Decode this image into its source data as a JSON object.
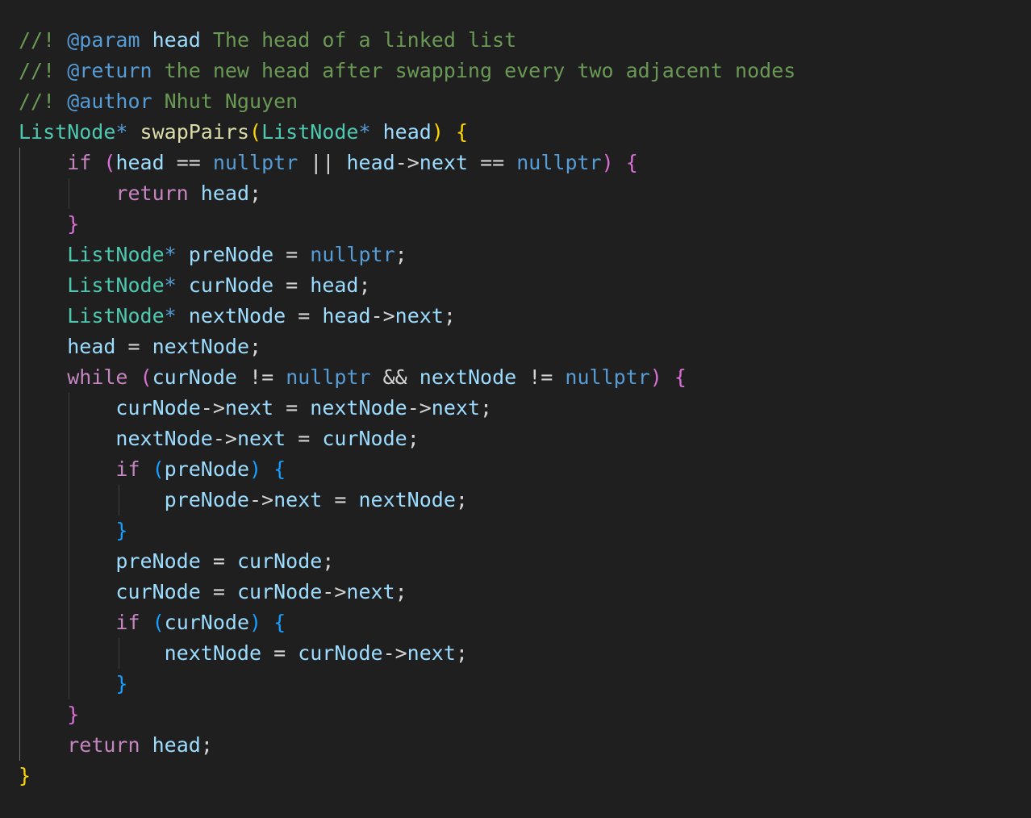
{
  "editor": {
    "theme": "dark",
    "background": "#1f1f1f",
    "colors": {
      "comment": "#6a9955",
      "doc_tag": "#569cd6",
      "type": "#4ec9b0",
      "function": "#dcdcaa",
      "variable": "#9cdcfe",
      "keyword": "#569cd6",
      "control": "#c586c0",
      "bracket_level_1": "#ffd700",
      "bracket_level_2": "#da70d6",
      "bracket_level_3": "#179fff"
    },
    "lines": [
      {
        "indent": 0,
        "guides": [],
        "tokens": [
          {
            "t": "comment",
            "v": "//! "
          },
          {
            "t": "doctag",
            "v": "@param"
          },
          {
            "t": "comment",
            "v": " "
          },
          {
            "t": "doctext",
            "v": "head"
          },
          {
            "t": "comment",
            "v": " The head of a linked list"
          }
        ]
      },
      {
        "indent": 0,
        "guides": [],
        "tokens": [
          {
            "t": "comment",
            "v": "//! "
          },
          {
            "t": "doctag",
            "v": "@return"
          },
          {
            "t": "comment",
            "v": " the new head after swapping every two adjacent nodes"
          }
        ]
      },
      {
        "indent": 0,
        "guides": [],
        "tokens": [
          {
            "t": "comment",
            "v": "//! "
          },
          {
            "t": "doctag",
            "v": "@author"
          },
          {
            "t": "comment",
            "v": " Nhut Nguyen"
          }
        ]
      },
      {
        "indent": 0,
        "guides": [],
        "tokens": [
          {
            "t": "type",
            "v": "ListNode"
          },
          {
            "t": "keyword",
            "v": "*"
          },
          {
            "t": "op",
            "v": " "
          },
          {
            "t": "func",
            "v": "swapPairs"
          },
          {
            "t": "brace-1",
            "v": "("
          },
          {
            "t": "type",
            "v": "ListNode"
          },
          {
            "t": "keyword",
            "v": "*"
          },
          {
            "t": "op",
            "v": " "
          },
          {
            "t": "param",
            "v": "head"
          },
          {
            "t": "brace-1",
            "v": ")"
          },
          {
            "t": "op",
            "v": " "
          },
          {
            "t": "brace-1",
            "v": "{"
          }
        ]
      },
      {
        "indent": 1,
        "guides": [
          0
        ],
        "tokens": [
          {
            "t": "control",
            "v": "if"
          },
          {
            "t": "op",
            "v": " "
          },
          {
            "t": "brace-2",
            "v": "("
          },
          {
            "t": "var",
            "v": "head"
          },
          {
            "t": "op",
            "v": " == "
          },
          {
            "t": "keyword",
            "v": "nullptr"
          },
          {
            "t": "op",
            "v": " || "
          },
          {
            "t": "var",
            "v": "head"
          },
          {
            "t": "op",
            "v": "->"
          },
          {
            "t": "var",
            "v": "next"
          },
          {
            "t": "op",
            "v": " == "
          },
          {
            "t": "keyword",
            "v": "nullptr"
          },
          {
            "t": "brace-2",
            "v": ")"
          },
          {
            "t": "op",
            "v": " "
          },
          {
            "t": "brace-2",
            "v": "{"
          }
        ]
      },
      {
        "indent": 2,
        "guides": [
          0,
          1
        ],
        "tokens": [
          {
            "t": "control",
            "v": "return"
          },
          {
            "t": "op",
            "v": " "
          },
          {
            "t": "var",
            "v": "head"
          },
          {
            "t": "punct",
            "v": ";"
          }
        ]
      },
      {
        "indent": 1,
        "guides": [
          0
        ],
        "tokens": [
          {
            "t": "brace-2",
            "v": "}"
          }
        ]
      },
      {
        "indent": 1,
        "guides": [
          0
        ],
        "tokens": [
          {
            "t": "type",
            "v": "ListNode"
          },
          {
            "t": "keyword",
            "v": "*"
          },
          {
            "t": "op",
            "v": " "
          },
          {
            "t": "var",
            "v": "preNode"
          },
          {
            "t": "op",
            "v": " = "
          },
          {
            "t": "keyword",
            "v": "nullptr"
          },
          {
            "t": "punct",
            "v": ";"
          }
        ]
      },
      {
        "indent": 1,
        "guides": [
          0
        ],
        "tokens": [
          {
            "t": "type",
            "v": "ListNode"
          },
          {
            "t": "keyword",
            "v": "*"
          },
          {
            "t": "op",
            "v": " "
          },
          {
            "t": "var",
            "v": "curNode"
          },
          {
            "t": "op",
            "v": " = "
          },
          {
            "t": "var",
            "v": "head"
          },
          {
            "t": "punct",
            "v": ";"
          }
        ]
      },
      {
        "indent": 1,
        "guides": [
          0
        ],
        "tokens": [
          {
            "t": "type",
            "v": "ListNode"
          },
          {
            "t": "keyword",
            "v": "*"
          },
          {
            "t": "op",
            "v": " "
          },
          {
            "t": "var",
            "v": "nextNode"
          },
          {
            "t": "op",
            "v": " = "
          },
          {
            "t": "var",
            "v": "head"
          },
          {
            "t": "op",
            "v": "->"
          },
          {
            "t": "var",
            "v": "next"
          },
          {
            "t": "punct",
            "v": ";"
          }
        ]
      },
      {
        "indent": 1,
        "guides": [
          0
        ],
        "tokens": [
          {
            "t": "var",
            "v": "head"
          },
          {
            "t": "op",
            "v": " = "
          },
          {
            "t": "var",
            "v": "nextNode"
          },
          {
            "t": "punct",
            "v": ";"
          }
        ]
      },
      {
        "indent": 1,
        "guides": [
          0
        ],
        "tokens": [
          {
            "t": "control",
            "v": "while"
          },
          {
            "t": "op",
            "v": " "
          },
          {
            "t": "brace-2",
            "v": "("
          },
          {
            "t": "var",
            "v": "curNode"
          },
          {
            "t": "op",
            "v": " != "
          },
          {
            "t": "keyword",
            "v": "nullptr"
          },
          {
            "t": "op",
            "v": " && "
          },
          {
            "t": "var",
            "v": "nextNode"
          },
          {
            "t": "op",
            "v": " != "
          },
          {
            "t": "keyword",
            "v": "nullptr"
          },
          {
            "t": "brace-2",
            "v": ")"
          },
          {
            "t": "op",
            "v": " "
          },
          {
            "t": "brace-2",
            "v": "{"
          }
        ]
      },
      {
        "indent": 2,
        "guides": [
          0,
          1
        ],
        "tokens": [
          {
            "t": "var",
            "v": "curNode"
          },
          {
            "t": "op",
            "v": "->"
          },
          {
            "t": "var",
            "v": "next"
          },
          {
            "t": "op",
            "v": " = "
          },
          {
            "t": "var",
            "v": "nextNode"
          },
          {
            "t": "op",
            "v": "->"
          },
          {
            "t": "var",
            "v": "next"
          },
          {
            "t": "punct",
            "v": ";"
          }
        ]
      },
      {
        "indent": 2,
        "guides": [
          0,
          1
        ],
        "tokens": [
          {
            "t": "var",
            "v": "nextNode"
          },
          {
            "t": "op",
            "v": "->"
          },
          {
            "t": "var",
            "v": "next"
          },
          {
            "t": "op",
            "v": " = "
          },
          {
            "t": "var",
            "v": "curNode"
          },
          {
            "t": "punct",
            "v": ";"
          }
        ]
      },
      {
        "indent": 2,
        "guides": [
          0,
          1
        ],
        "tokens": [
          {
            "t": "control",
            "v": "if"
          },
          {
            "t": "op",
            "v": " "
          },
          {
            "t": "brace-3",
            "v": "("
          },
          {
            "t": "var",
            "v": "preNode"
          },
          {
            "t": "brace-3",
            "v": ")"
          },
          {
            "t": "op",
            "v": " "
          },
          {
            "t": "brace-3",
            "v": "{"
          }
        ]
      },
      {
        "indent": 3,
        "guides": [
          0,
          1,
          2
        ],
        "tokens": [
          {
            "t": "var",
            "v": "preNode"
          },
          {
            "t": "op",
            "v": "->"
          },
          {
            "t": "var",
            "v": "next"
          },
          {
            "t": "op",
            "v": " = "
          },
          {
            "t": "var",
            "v": "nextNode"
          },
          {
            "t": "punct",
            "v": ";"
          }
        ]
      },
      {
        "indent": 2,
        "guides": [
          0,
          1
        ],
        "tokens": [
          {
            "t": "brace-3",
            "v": "}"
          }
        ]
      },
      {
        "indent": 2,
        "guides": [
          0,
          1
        ],
        "tokens": [
          {
            "t": "var",
            "v": "preNode"
          },
          {
            "t": "op",
            "v": " = "
          },
          {
            "t": "var",
            "v": "curNode"
          },
          {
            "t": "punct",
            "v": ";"
          }
        ]
      },
      {
        "indent": 2,
        "guides": [
          0,
          1
        ],
        "tokens": [
          {
            "t": "var",
            "v": "curNode"
          },
          {
            "t": "op",
            "v": " = "
          },
          {
            "t": "var",
            "v": "curNode"
          },
          {
            "t": "op",
            "v": "->"
          },
          {
            "t": "var",
            "v": "next"
          },
          {
            "t": "punct",
            "v": ";"
          }
        ]
      },
      {
        "indent": 2,
        "guides": [
          0,
          1
        ],
        "tokens": [
          {
            "t": "control",
            "v": "if"
          },
          {
            "t": "op",
            "v": " "
          },
          {
            "t": "brace-3",
            "v": "("
          },
          {
            "t": "var",
            "v": "curNode"
          },
          {
            "t": "brace-3",
            "v": ")"
          },
          {
            "t": "op",
            "v": " "
          },
          {
            "t": "brace-3",
            "v": "{"
          }
        ]
      },
      {
        "indent": 3,
        "guides": [
          0,
          1,
          2
        ],
        "tokens": [
          {
            "t": "var",
            "v": "nextNode"
          },
          {
            "t": "op",
            "v": " = "
          },
          {
            "t": "var",
            "v": "curNode"
          },
          {
            "t": "op",
            "v": "->"
          },
          {
            "t": "var",
            "v": "next"
          },
          {
            "t": "punct",
            "v": ";"
          }
        ]
      },
      {
        "indent": 2,
        "guides": [
          0,
          1
        ],
        "tokens": [
          {
            "t": "brace-3",
            "v": "}"
          }
        ]
      },
      {
        "indent": 1,
        "guides": [
          0
        ],
        "tokens": [
          {
            "t": "brace-2",
            "v": "}"
          }
        ]
      },
      {
        "indent": 1,
        "guides": [
          0
        ],
        "tokens": [
          {
            "t": "control",
            "v": "return"
          },
          {
            "t": "op",
            "v": " "
          },
          {
            "t": "var",
            "v": "head"
          },
          {
            "t": "punct",
            "v": ";"
          }
        ]
      },
      {
        "indent": 0,
        "guides": [],
        "tokens": [
          {
            "t": "brace-1",
            "v": "}"
          }
        ]
      }
    ]
  }
}
